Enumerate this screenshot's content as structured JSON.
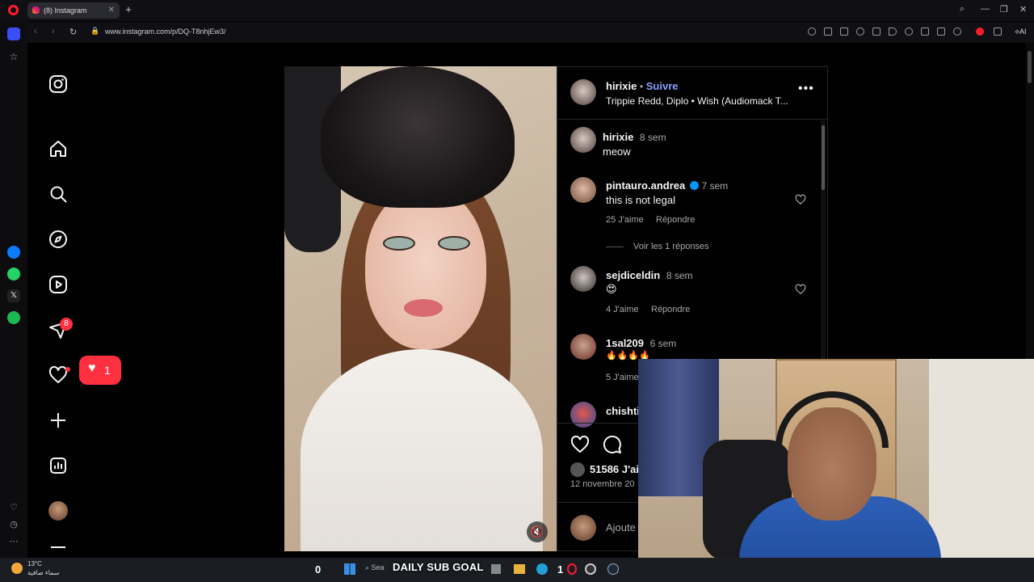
{
  "browser": {
    "tab_title": "(8) Instagram",
    "url": "www.instagram.com/p/DQ-T8nhjEw3/",
    "ai_label": "AI"
  },
  "instagram_nav": {
    "messages_badge": "8",
    "notification_popup_count": "1"
  },
  "post": {
    "author": "hirixie",
    "follow_label": "Suivre",
    "separator": "•",
    "audio": "Trippie Redd, Diplo • Wish (Audiomack T...",
    "more_icon": "more-horizontal-icon",
    "caption": {
      "user": "hirixie",
      "time": "8 sem",
      "text": "meow"
    },
    "comments": [
      {
        "user": "pintauro.andrea",
        "verified": true,
        "time": "7 sem",
        "text": "this is not legal",
        "likes": "25 J'aime",
        "reply": "Répondre",
        "see_replies": "Voir les 1 réponses"
      },
      {
        "user": "sejdiceldin",
        "time": "8 sem",
        "text": "😍",
        "likes": "4 J'aime",
        "reply": "Répondre"
      },
      {
        "user": "1sal209",
        "time": "6 sem",
        "text": "🔥🔥🔥🔥",
        "likes": "5 J'aime"
      },
      {
        "user": "chishti",
        "time": "",
        "text": ""
      }
    ],
    "likes_count": "51586 J'ai",
    "date": "12 novembre 20",
    "add_comment_placeholder": "Ajoute"
  },
  "taskbar": {
    "weather_temp": "13°C",
    "weather_desc": "سماء صافية",
    "counter_left": "0",
    "sub_goal_label": "DAILY SUB GOAL",
    "counter_right": "1",
    "search_placeholder": "Sea"
  },
  "colors": {
    "accent_blue": "#85a1ff",
    "verified_blue": "#0095f6",
    "notification_red": "#ff3040",
    "opera_red": "#ff1b2d"
  }
}
